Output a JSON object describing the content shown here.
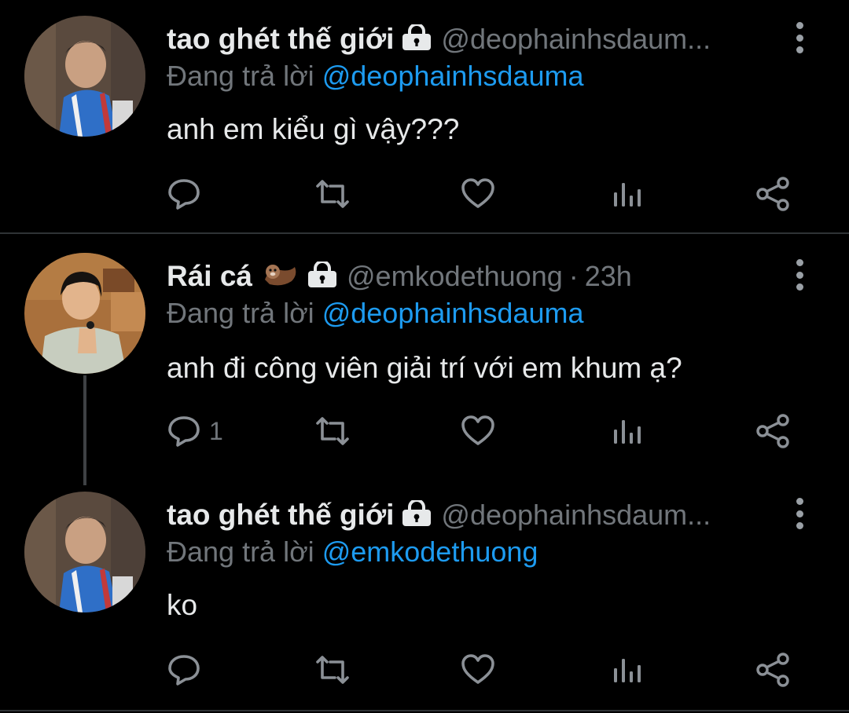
{
  "tweets": [
    {
      "name": "tao ghét thế giới",
      "handle": "@deophainhsdaum...",
      "time": "",
      "replying_prefix": "Đang trả lời",
      "replying_to": "@deophainhsdauma",
      "text": "anh em kiểu gì vậy???",
      "reply_count": ""
    },
    {
      "name": "Rái cá",
      "handle": "@emkodethuong",
      "dot": "·",
      "time": "23h",
      "replying_prefix": "Đang trả lời",
      "replying_to": "@deophainhsdauma",
      "text": "anh đi công viên giải trí với em khum ạ?",
      "reply_count": "1"
    },
    {
      "name": "tao ghét thế giới",
      "handle": "@deophainhsdaum...",
      "time": "",
      "replying_prefix": "Đang trả lời",
      "replying_to": "@emkodethuong",
      "text": "ko",
      "reply_count": ""
    }
  ],
  "icons": {
    "reply": "reply-icon",
    "retweet": "retweet-icon",
    "like": "heart-icon",
    "views": "views-icon",
    "share": "share-icon",
    "lock": "lock-icon",
    "more": "more-vertical-icon",
    "otter": "otter-emoji-icon"
  },
  "colors": {
    "background": "#000000",
    "text": "#e7e9ea",
    "muted": "#71767b",
    "link": "#1d9bf0",
    "separator": "#2f3336"
  }
}
